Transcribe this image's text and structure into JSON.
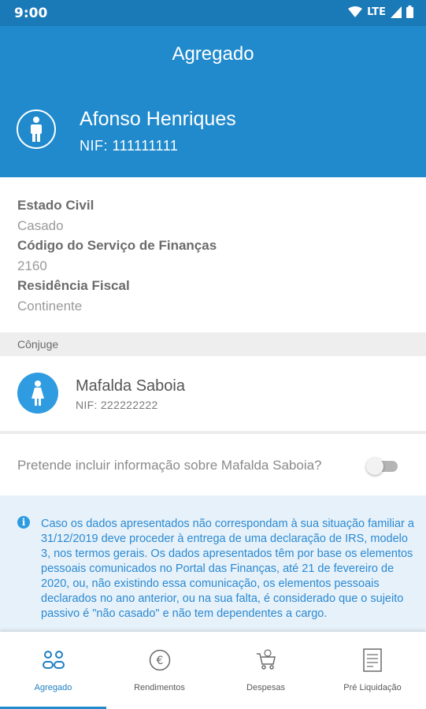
{
  "status_bar": {
    "time": "9:00",
    "network": "LTE",
    "icons": [
      "wifi-icon",
      "cellular-signal-icon",
      "battery-icon"
    ]
  },
  "header": {
    "title": "Agregado",
    "person": {
      "name": "Afonso Henriques",
      "nif": "NIF: 111111111",
      "icon": "male-person-icon"
    }
  },
  "details": [
    {
      "label": "Estado Civil",
      "value": "Casado"
    },
    {
      "label": "Código do Serviço de Finanças",
      "value": "2160"
    },
    {
      "label": "Residência Fiscal",
      "value": "Continente"
    }
  ],
  "spouse_section": {
    "title": "Cônjuge",
    "name": "Mafalda Saboia",
    "nif": "NIF: 222222222",
    "icon": "female-person-icon"
  },
  "include_toggle": {
    "label": "Pretende incluir informação sobre Mafalda Saboia?",
    "checked": false
  },
  "notice": {
    "icon": "info-icon",
    "text": "Caso os dados apresentados não correspondam à sua situação familiar a 31/12/2019 deve proceder à entrega de uma declaração de IRS, modelo 3, nos termos gerais. Os dados apresentados têm por base os elementos pessoais comunicados no Portal das Finanças, até 21 de fevereiro de 2020, ou, não existindo essa comunicação, os elementos pessoais declarados no ano anterior, ou na sua falta, é considerado que o sujeito passivo é \"não casado\" e não tem dependentes a cargo."
  },
  "bottom_nav": [
    {
      "label": "Agregado",
      "icon": "household-icon",
      "active": true
    },
    {
      "label": "Rendimentos",
      "icon": "euro-icon",
      "active": false
    },
    {
      "label": "Despesas",
      "icon": "shopping-cart-icon",
      "active": false
    },
    {
      "label": "Pré Liquidação",
      "icon": "document-icon",
      "active": false
    }
  ],
  "colors": {
    "header": "#208acc",
    "status_bar": "#1a79b7",
    "accent": "#2d9be2",
    "notice_bg": "#e7f1f9"
  }
}
